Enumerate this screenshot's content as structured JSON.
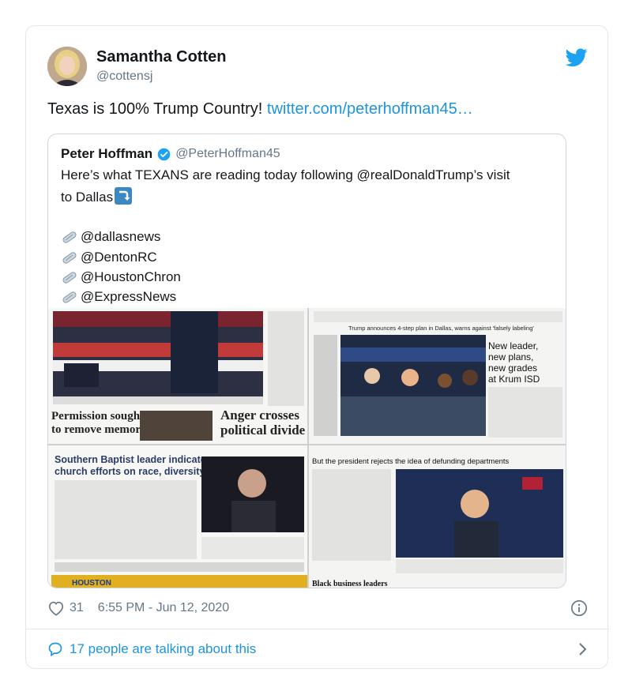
{
  "author": {
    "name": "Samantha Cotten",
    "handle": "@cottensj"
  },
  "tweet": {
    "text": "Texas is 100% Trump Country! ",
    "link": "twitter.com/peterhoffman45…"
  },
  "quote": {
    "name": "Peter Hoffman",
    "handle": "@PeterHoffman45",
    "line1": "Here’s what TEXANS are reading today following @realDonaldTrump’s visit",
    "line2": "to Dallas",
    "mentions": [
      "@dallasnews",
      "@DentonRC",
      "@HoustonChron",
      "@ExpressNews"
    ]
  },
  "newspapers": {
    "p1_head_left": "Permission sought",
    "p1_head_left2": "to remove memorial",
    "p1_head_right": "Anger crosses",
    "p1_head_right2": "political divide",
    "p2_banner": "Trump announces 4-step plan in Dallas, warns against 'falsely labeling'",
    "p2_side1": "New leader,",
    "p2_side2": "new plans,",
    "p2_side3": "new grades",
    "p2_side4": "at Krum ISD",
    "p3_head1": "Southern Baptist leader indicates",
    "p3_head2": "church efforts on race, diversity",
    "p3_banner": "HOUSTON",
    "p4_head": "But the president rejects the idea of defunding departments",
    "p4_bottom": "Black business leaders"
  },
  "footer": {
    "likes": "31",
    "timestamp": "6:55 PM - Jun 12, 2020",
    "talking": "17 people are talking about this"
  },
  "colors": {
    "link": "#1b95e0",
    "secondary_text": "#657786",
    "border": "#e1e8ed"
  },
  "icons": [
    "twitter-bird-icon",
    "verified-icon",
    "rolled-newspaper-icon",
    "right-arrow-curving-down-icon",
    "heart-icon",
    "info-icon",
    "speech-bubble-icon",
    "chevron-right-icon"
  ]
}
